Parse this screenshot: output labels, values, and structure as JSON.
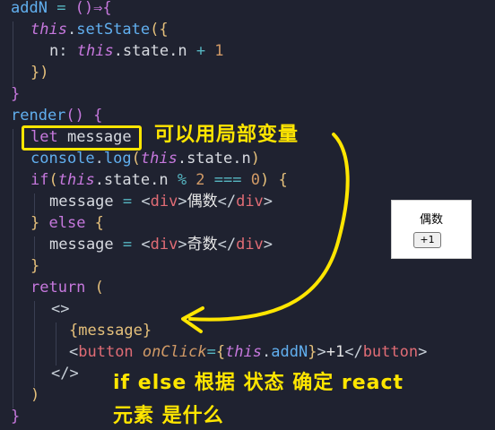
{
  "code": {
    "l1": {
      "name": "addN",
      "eq": " = ",
      "arrow": "()⇒{"
    },
    "l2": {
      "this": "this",
      "dot": ".",
      "fn": "setState",
      "open": "({"
    },
    "l3": {
      "key": "n",
      "colon": ": ",
      "this": "this",
      "path": ".state.n",
      "plus": " + ",
      "num": "1"
    },
    "l4": {
      "close": "})"
    },
    "l5": {
      "close": "}"
    },
    "l6": {
      "fn": "render",
      "rest": "() {"
    },
    "l7": {
      "kw": "let",
      "name": " message"
    },
    "l8": {
      "obj": "console",
      "dot": ".",
      "fn": "log",
      "open": "(",
      "this": "this",
      "path": ".state.n",
      "close": ")"
    },
    "l9": {
      "kw": "if",
      "open": "(",
      "this": "this",
      "path": ".state.n ",
      "mod": "%",
      "num1": " 2 ",
      "eqeq": "===",
      "num2": " 0",
      "close": ") {"
    },
    "l10": {
      "name": "message",
      "eq": " = ",
      "lt": "<",
      "tag": "div",
      "gt": ">",
      "text": "偶数",
      "endlt": "</",
      "endtag": "div",
      "endgt": ">"
    },
    "l11": {
      "close": "} ",
      "kw": "else",
      "open": " {"
    },
    "l12": {
      "name": "message",
      "eq": " = ",
      "lt": "<",
      "tag": "div",
      "gt": ">",
      "text": "奇数",
      "endlt": "</",
      "endtag": "div",
      "endgt": ">"
    },
    "l13": {
      "close": "}"
    },
    "l14": {
      "kw": "return",
      "open": " ("
    },
    "l15": {
      "frag": "<>"
    },
    "l16": {
      "expr": "{message}"
    },
    "l17": {
      "lt": "<",
      "tag": "button",
      "attr": " onClick",
      "eq": "=",
      "ob": "{",
      "this": "this",
      "dot": ".",
      "fn": "addN",
      "cb": "}",
      "gt": ">",
      "text": "+1",
      "endlt": "</",
      "endtag": "button",
      "endgt": ">"
    },
    "l18": {
      "frag": "</>"
    },
    "l19": {
      "close": ")"
    },
    "l20": {
      "close": "}"
    }
  },
  "annotations": {
    "local_var": "可以用局部变量",
    "explain_line1": "if else 根据 状态 确定 react",
    "explain_line2": "元素 是什么"
  },
  "preview": {
    "text": "偶数",
    "button_label": "+1"
  },
  "colors": {
    "background": "#1f2230",
    "annotation": "#ffe600"
  }
}
